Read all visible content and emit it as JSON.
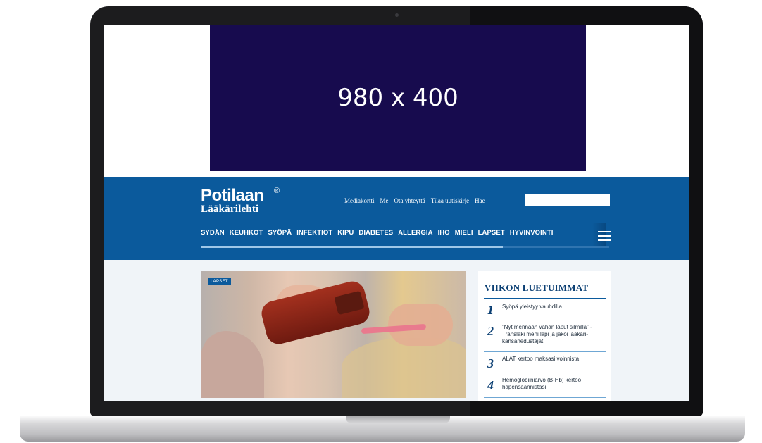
{
  "ad": {
    "label": "980 x 400"
  },
  "header": {
    "logo_main": "Potilaan",
    "logo_sub": "Lääkärilehti",
    "logo_mark": "®",
    "top_links": [
      "Mediakortti",
      "Me",
      "Ota yhteyttä",
      "Tilaa uutiskirje",
      "Hae"
    ],
    "search_placeholder": ""
  },
  "nav": {
    "items": [
      "SYDÄN",
      "KEUHKOT",
      "SYÖPÄ",
      "INFEKTIOT",
      "KIPU",
      "DIABETES",
      "ALLERGIA",
      "IHO",
      "MIELI",
      "LAPSET",
      "HYVINVOINTI"
    ],
    "menu_icon": "hamburger-icon",
    "scroll_progress": 0.74
  },
  "hero": {
    "category": "LAPSET"
  },
  "most_read": {
    "title": "VIIKON LUETUIMMAT",
    "items": [
      {
        "rank": "1",
        "title": "Syöpä yleistyy vauhdilla"
      },
      {
        "rank": "2",
        "title": "”Nyt mennään vähän laput silmillä” - Translaki meni läpi ja jakoi lääkäri­kansanedustajat"
      },
      {
        "rank": "3",
        "title": "ALAT kertoo maksasi voinnista"
      },
      {
        "rank": "4",
        "title": "Hemoglobiiniarvo (B-Hb) kertoo hapensaannistasi"
      }
    ]
  },
  "colors": {
    "brand": "#0b5a9c",
    "ad_background": "#170b4e",
    "page_background": "#f0f4f8"
  }
}
